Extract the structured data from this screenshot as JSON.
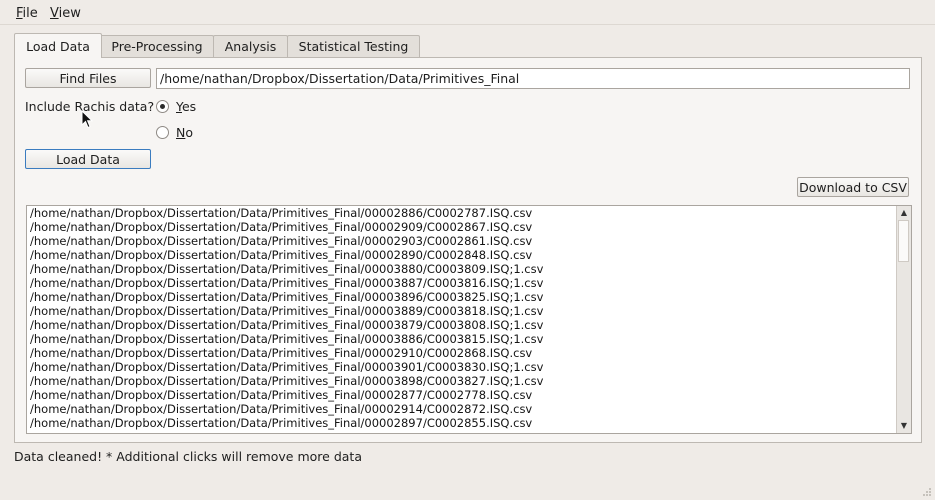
{
  "menubar": {
    "file": {
      "mnemonic": "F",
      "rest": "ile"
    },
    "view": {
      "mnemonic": "V",
      "rest": "iew"
    }
  },
  "tabs": [
    {
      "label": "Load Data",
      "active": true
    },
    {
      "label": "Pre-Processing",
      "active": false
    },
    {
      "label": "Analysis",
      "active": false
    },
    {
      "label": "Statistical Testing",
      "active": false
    }
  ],
  "load": {
    "find_files_label": "Find Files",
    "path_value": "/home/nathan/Dropbox/Dissertation/Data/Primitives_Final",
    "rachis_question": "Include Rachis data?",
    "yes": {
      "mnemonic": "Y",
      "rest": "es",
      "checked": true
    },
    "no": {
      "mnemonic": "N",
      "rest": "o",
      "checked": false
    },
    "load_data_label": "Load Data",
    "download_label": "Download to CSV"
  },
  "files": [
    "/home/nathan/Dropbox/Dissertation/Data/Primitives_Final/00002886/C0002787.ISQ.csv",
    "/home/nathan/Dropbox/Dissertation/Data/Primitives_Final/00002909/C0002867.ISQ.csv",
    "/home/nathan/Dropbox/Dissertation/Data/Primitives_Final/00002903/C0002861.ISQ.csv",
    "/home/nathan/Dropbox/Dissertation/Data/Primitives_Final/00002890/C0002848.ISQ.csv",
    "/home/nathan/Dropbox/Dissertation/Data/Primitives_Final/00003880/C0003809.ISQ;1.csv",
    "/home/nathan/Dropbox/Dissertation/Data/Primitives_Final/00003887/C0003816.ISQ;1.csv",
    "/home/nathan/Dropbox/Dissertation/Data/Primitives_Final/00003896/C0003825.ISQ;1.csv",
    "/home/nathan/Dropbox/Dissertation/Data/Primitives_Final/00003889/C0003818.ISQ;1.csv",
    "/home/nathan/Dropbox/Dissertation/Data/Primitives_Final/00003879/C0003808.ISQ;1.csv",
    "/home/nathan/Dropbox/Dissertation/Data/Primitives_Final/00003886/C0003815.ISQ;1.csv",
    "/home/nathan/Dropbox/Dissertation/Data/Primitives_Final/00002910/C0002868.ISQ.csv",
    "/home/nathan/Dropbox/Dissertation/Data/Primitives_Final/00003901/C0003830.ISQ;1.csv",
    "/home/nathan/Dropbox/Dissertation/Data/Primitives_Final/00003898/C0003827.ISQ;1.csv",
    "/home/nathan/Dropbox/Dissertation/Data/Primitives_Final/00002877/C0002778.ISQ.csv",
    "/home/nathan/Dropbox/Dissertation/Data/Primitives_Final/00002914/C0002872.ISQ.csv",
    "/home/nathan/Dropbox/Dissertation/Data/Primitives_Final/00002897/C0002855.ISQ.csv"
  ],
  "status_text": "Data cleaned! * Additional clicks will remove more data",
  "icons": {
    "scroll_up": "up-arrow-icon",
    "scroll_down": "down-arrow-icon",
    "cursor": "mouse-pointer-icon",
    "size_grip": "size-grip-icon"
  },
  "colors": {
    "window_bg": "#efebe7",
    "focus_border": "#3b7cbf"
  }
}
